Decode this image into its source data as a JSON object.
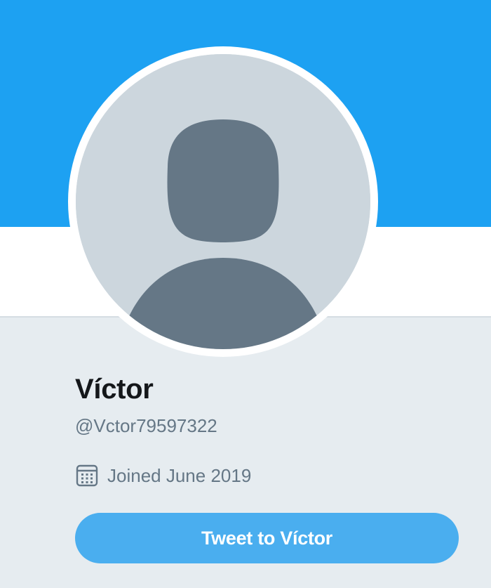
{
  "profile": {
    "display_name": "Víctor",
    "handle": "@Vctor79597322",
    "joined": "Joined June 2019",
    "avatar_icon": "default-avatar-silhouette",
    "calendar_icon": "calendar-icon"
  },
  "actions": {
    "tweet_to_label": "Tweet to Víctor"
  },
  "colors": {
    "banner": "#1da1f2",
    "page_background": "#e6ecf0",
    "avatar_background": "#ccd6dd",
    "avatar_silhouette": "#657786",
    "button_background": "#4aaeef",
    "button_text": "#ffffff",
    "name_text": "#14171a",
    "secondary_text": "#657786"
  }
}
